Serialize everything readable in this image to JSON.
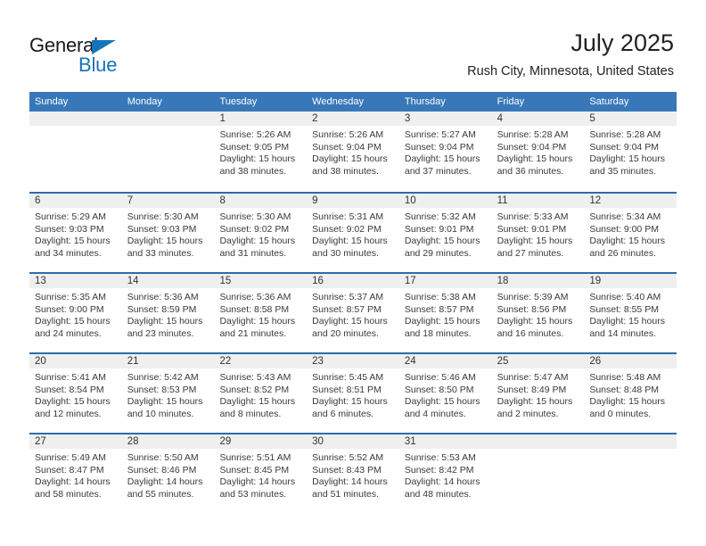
{
  "brand": {
    "name_part1": "General",
    "name_part2": "Blue",
    "accent_color": "#1574bb"
  },
  "header": {
    "title": "July 2025",
    "subtitle": "Rush City, Minnesota, United States"
  },
  "theme": {
    "header_blue": "#3878b9",
    "row_divider_blue": "#2c6cab",
    "daynum_band_gray": "#efefef"
  },
  "weekdays": [
    "Sunday",
    "Monday",
    "Tuesday",
    "Wednesday",
    "Thursday",
    "Friday",
    "Saturday"
  ],
  "weeks": [
    [
      {
        "day": "",
        "info": ""
      },
      {
        "day": "",
        "info": ""
      },
      {
        "day": "1",
        "info": "Sunrise: 5:26 AM\nSunset: 9:05 PM\nDaylight: 15 hours\nand 38 minutes."
      },
      {
        "day": "2",
        "info": "Sunrise: 5:26 AM\nSunset: 9:04 PM\nDaylight: 15 hours\nand 38 minutes."
      },
      {
        "day": "3",
        "info": "Sunrise: 5:27 AM\nSunset: 9:04 PM\nDaylight: 15 hours\nand 37 minutes."
      },
      {
        "day": "4",
        "info": "Sunrise: 5:28 AM\nSunset: 9:04 PM\nDaylight: 15 hours\nand 36 minutes."
      },
      {
        "day": "5",
        "info": "Sunrise: 5:28 AM\nSunset: 9:04 PM\nDaylight: 15 hours\nand 35 minutes."
      }
    ],
    [
      {
        "day": "6",
        "info": "Sunrise: 5:29 AM\nSunset: 9:03 PM\nDaylight: 15 hours\nand 34 minutes."
      },
      {
        "day": "7",
        "info": "Sunrise: 5:30 AM\nSunset: 9:03 PM\nDaylight: 15 hours\nand 33 minutes."
      },
      {
        "day": "8",
        "info": "Sunrise: 5:30 AM\nSunset: 9:02 PM\nDaylight: 15 hours\nand 31 minutes."
      },
      {
        "day": "9",
        "info": "Sunrise: 5:31 AM\nSunset: 9:02 PM\nDaylight: 15 hours\nand 30 minutes."
      },
      {
        "day": "10",
        "info": "Sunrise: 5:32 AM\nSunset: 9:01 PM\nDaylight: 15 hours\nand 29 minutes."
      },
      {
        "day": "11",
        "info": "Sunrise: 5:33 AM\nSunset: 9:01 PM\nDaylight: 15 hours\nand 27 minutes."
      },
      {
        "day": "12",
        "info": "Sunrise: 5:34 AM\nSunset: 9:00 PM\nDaylight: 15 hours\nand 26 minutes."
      }
    ],
    [
      {
        "day": "13",
        "info": "Sunrise: 5:35 AM\nSunset: 9:00 PM\nDaylight: 15 hours\nand 24 minutes."
      },
      {
        "day": "14",
        "info": "Sunrise: 5:36 AM\nSunset: 8:59 PM\nDaylight: 15 hours\nand 23 minutes."
      },
      {
        "day": "15",
        "info": "Sunrise: 5:36 AM\nSunset: 8:58 PM\nDaylight: 15 hours\nand 21 minutes."
      },
      {
        "day": "16",
        "info": "Sunrise: 5:37 AM\nSunset: 8:57 PM\nDaylight: 15 hours\nand 20 minutes."
      },
      {
        "day": "17",
        "info": "Sunrise: 5:38 AM\nSunset: 8:57 PM\nDaylight: 15 hours\nand 18 minutes."
      },
      {
        "day": "18",
        "info": "Sunrise: 5:39 AM\nSunset: 8:56 PM\nDaylight: 15 hours\nand 16 minutes."
      },
      {
        "day": "19",
        "info": "Sunrise: 5:40 AM\nSunset: 8:55 PM\nDaylight: 15 hours\nand 14 minutes."
      }
    ],
    [
      {
        "day": "20",
        "info": "Sunrise: 5:41 AM\nSunset: 8:54 PM\nDaylight: 15 hours\nand 12 minutes."
      },
      {
        "day": "21",
        "info": "Sunrise: 5:42 AM\nSunset: 8:53 PM\nDaylight: 15 hours\nand 10 minutes."
      },
      {
        "day": "22",
        "info": "Sunrise: 5:43 AM\nSunset: 8:52 PM\nDaylight: 15 hours\nand 8 minutes."
      },
      {
        "day": "23",
        "info": "Sunrise: 5:45 AM\nSunset: 8:51 PM\nDaylight: 15 hours\nand 6 minutes."
      },
      {
        "day": "24",
        "info": "Sunrise: 5:46 AM\nSunset: 8:50 PM\nDaylight: 15 hours\nand 4 minutes."
      },
      {
        "day": "25",
        "info": "Sunrise: 5:47 AM\nSunset: 8:49 PM\nDaylight: 15 hours\nand 2 minutes."
      },
      {
        "day": "26",
        "info": "Sunrise: 5:48 AM\nSunset: 8:48 PM\nDaylight: 15 hours\nand 0 minutes."
      }
    ],
    [
      {
        "day": "27",
        "info": "Sunrise: 5:49 AM\nSunset: 8:47 PM\nDaylight: 14 hours\nand 58 minutes."
      },
      {
        "day": "28",
        "info": "Sunrise: 5:50 AM\nSunset: 8:46 PM\nDaylight: 14 hours\nand 55 minutes."
      },
      {
        "day": "29",
        "info": "Sunrise: 5:51 AM\nSunset: 8:45 PM\nDaylight: 14 hours\nand 53 minutes."
      },
      {
        "day": "30",
        "info": "Sunrise: 5:52 AM\nSunset: 8:43 PM\nDaylight: 14 hours\nand 51 minutes."
      },
      {
        "day": "31",
        "info": "Sunrise: 5:53 AM\nSunset: 8:42 PM\nDaylight: 14 hours\nand 48 minutes."
      },
      {
        "day": "",
        "info": ""
      },
      {
        "day": "",
        "info": ""
      }
    ]
  ]
}
